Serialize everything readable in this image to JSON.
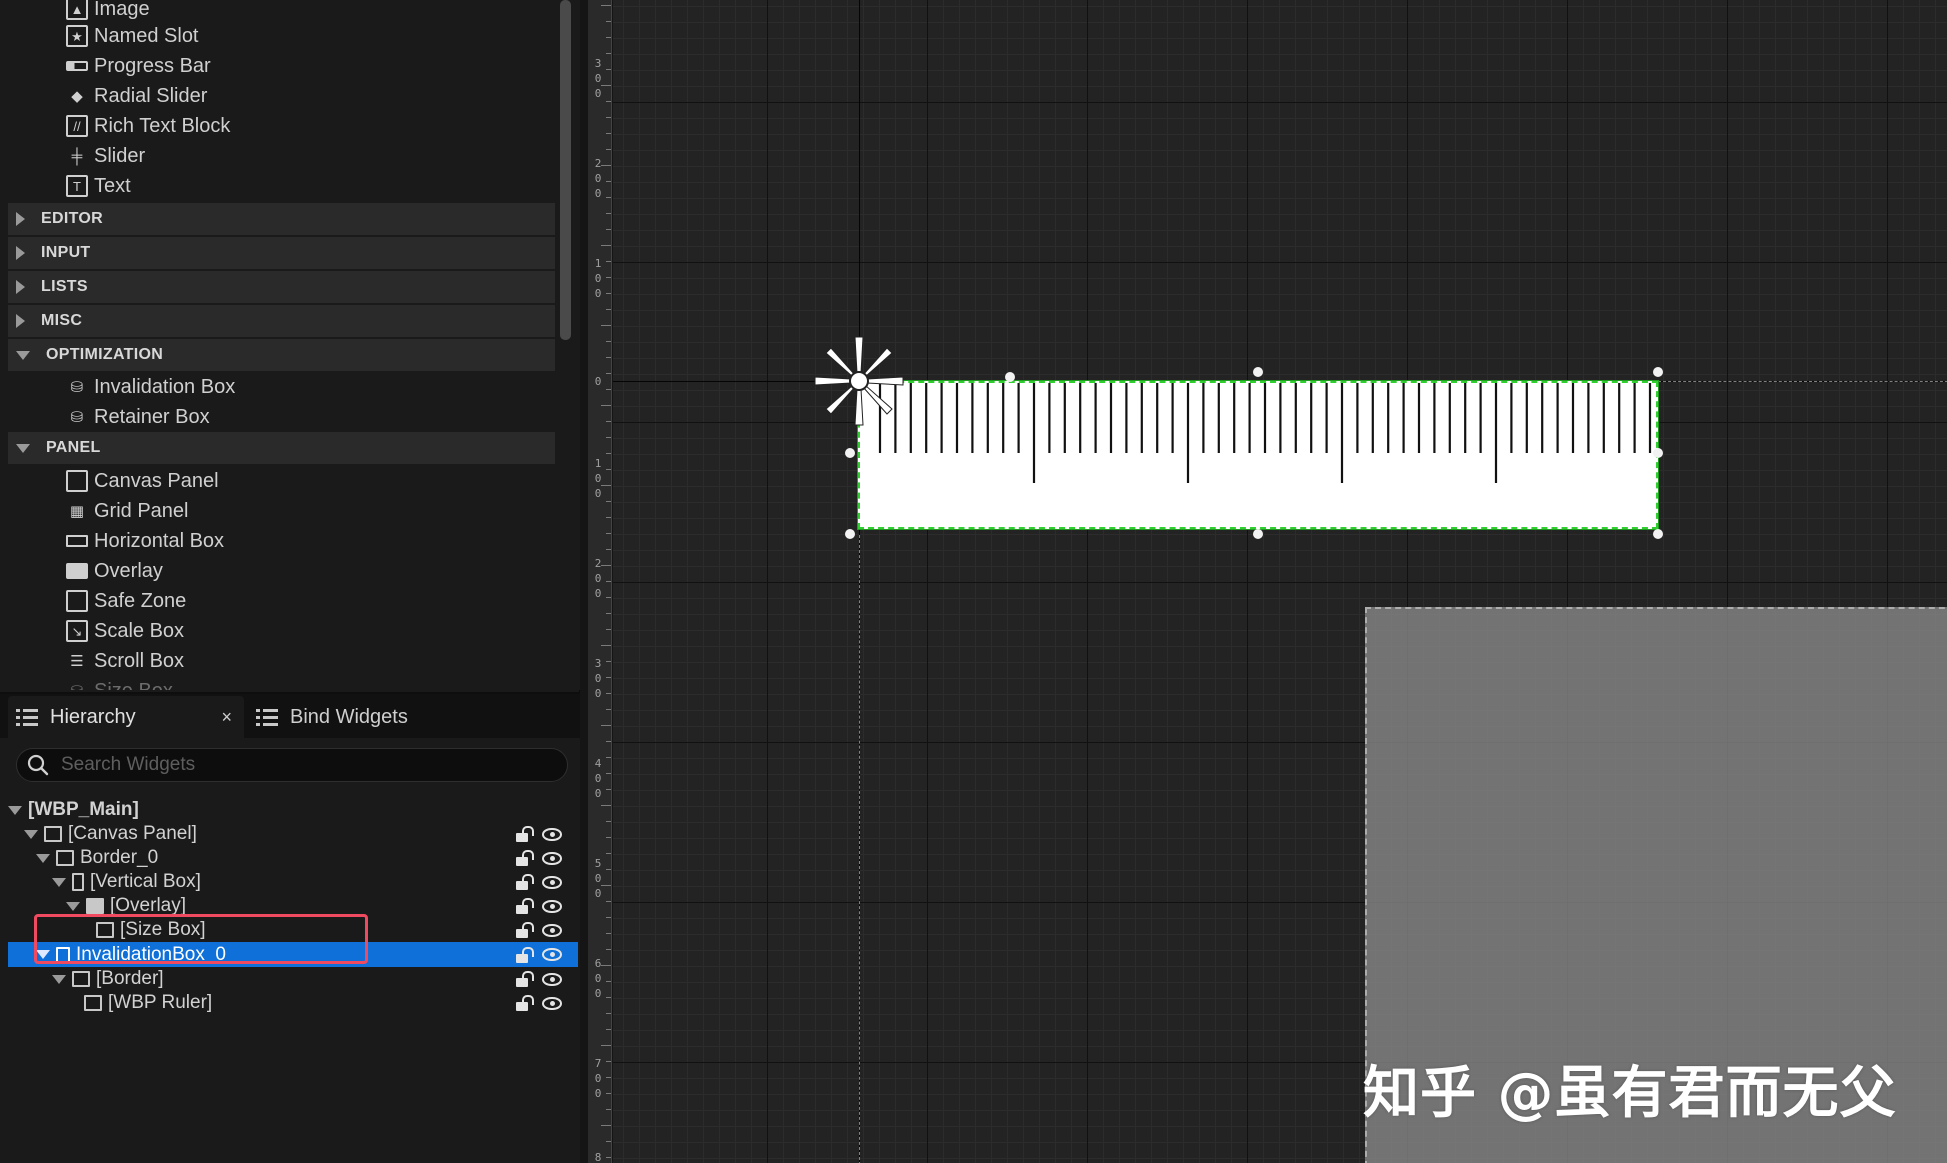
{
  "palette": {
    "items_top": [
      {
        "label": "Image",
        "icon": "image-icon"
      },
      {
        "label": "Named Slot",
        "icon": "named-slot-icon"
      },
      {
        "label": "Progress Bar",
        "icon": "progress-bar-icon"
      },
      {
        "label": "Radial Slider",
        "icon": "radial-slider-icon"
      },
      {
        "label": "Rich Text Block",
        "icon": "rich-text-icon"
      },
      {
        "label": "Slider",
        "icon": "slider-icon"
      },
      {
        "label": "Text",
        "icon": "text-icon"
      }
    ],
    "categories": [
      {
        "label": "EDITOR",
        "expanded": false
      },
      {
        "label": "INPUT",
        "expanded": false
      },
      {
        "label": "LISTS",
        "expanded": false
      },
      {
        "label": "MISC",
        "expanded": false
      },
      {
        "label": "OPTIMIZATION",
        "expanded": true
      },
      {
        "label": "PANEL",
        "expanded": true
      }
    ],
    "optimization_items": [
      {
        "label": "Invalidation Box",
        "icon": "invalidation-box-icon"
      },
      {
        "label": "Retainer Box",
        "icon": "retainer-box-icon"
      }
    ],
    "panel_items": [
      {
        "label": "Canvas Panel",
        "icon": "canvas-panel-icon"
      },
      {
        "label": "Grid Panel",
        "icon": "grid-panel-icon"
      },
      {
        "label": "Horizontal Box",
        "icon": "horizontal-box-icon"
      },
      {
        "label": "Overlay",
        "icon": "overlay-icon"
      },
      {
        "label": "Safe Zone",
        "icon": "safe-zone-icon"
      },
      {
        "label": "Scale Box",
        "icon": "scale-box-icon"
      },
      {
        "label": "Scroll Box",
        "icon": "scroll-box-icon"
      },
      {
        "label": "Size Box",
        "icon": "size-box-icon"
      }
    ]
  },
  "hierarchy": {
    "tabs": [
      {
        "label": "Hierarchy",
        "active": true,
        "close": "×"
      },
      {
        "label": "Bind Widgets",
        "active": false
      }
    ],
    "search_placeholder": "Search Widgets",
    "tree": [
      {
        "label": "[WBP_Main]",
        "depth": 0,
        "bold": true,
        "selected": false
      },
      {
        "label": "[Canvas Panel]",
        "depth": 1,
        "selected": false
      },
      {
        "label": "Border_0",
        "depth": 2,
        "selected": false
      },
      {
        "label": "[Vertical Box]",
        "depth": 3,
        "selected": false
      },
      {
        "label": "[Overlay]",
        "depth": 4,
        "selected": false
      },
      {
        "label": "[Size Box]",
        "depth": 5,
        "selected": false
      },
      {
        "label": "InvalidationBox_0",
        "depth": 2,
        "selected": true
      },
      {
        "label": "[Border]",
        "depth": 3,
        "selected": false
      },
      {
        "label": "[WBP Ruler]",
        "depth": 4,
        "selected": false
      }
    ]
  },
  "vruler": {
    "labels": [
      "3 0 0",
      "2 0 0",
      "1 0 0",
      "0",
      "1 0 0",
      "2 0 0",
      "3 0 0",
      "4 0 0",
      "5 0 0",
      "6 0 0",
      "7 0 0",
      "8"
    ]
  },
  "designer": {
    "widget": "WBP Ruler",
    "tick_count": 51,
    "accent_selection": "#2fd02f",
    "highlight_color": "#f04a60",
    "selection_color": "#0e70d8"
  },
  "watermark": "知乎 @虽有君而无父"
}
